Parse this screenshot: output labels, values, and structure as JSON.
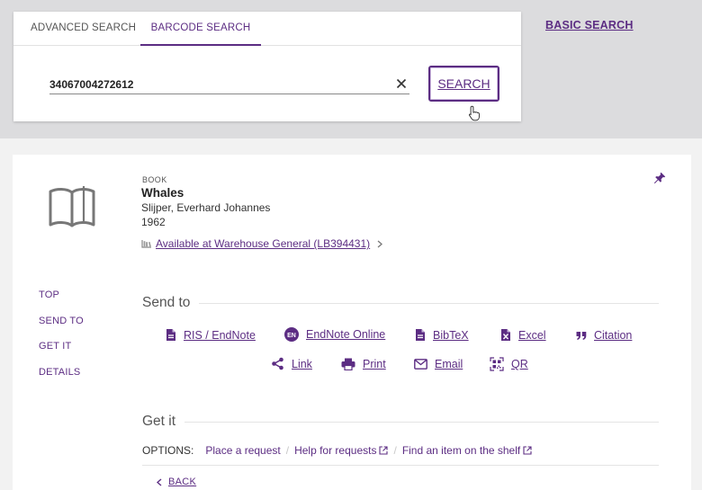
{
  "search": {
    "tabs": [
      {
        "label": "ADVANCED SEARCH"
      },
      {
        "label": "BARCODE SEARCH"
      }
    ],
    "barcode_value": "34067004272612",
    "search_button": "SEARCH",
    "basic_search": "BASIC SEARCH"
  },
  "record": {
    "type": "BOOK",
    "title": "Whales",
    "author": "Slijper, Everhard Johannes",
    "year": "1962",
    "availability": "Available at Warehouse  General (LB394431)"
  },
  "side_nav": [
    "TOP",
    "SEND TO",
    "GET IT",
    "DETAILS"
  ],
  "send_to": {
    "heading": "Send to",
    "actions": [
      {
        "label": "RIS / EndNote",
        "icon": "document-icon"
      },
      {
        "label": "EndNote Online",
        "icon": "endnote-badge-icon",
        "badge": "EN"
      },
      {
        "label": "BibTeX",
        "icon": "document-icon"
      },
      {
        "label": "Excel",
        "icon": "excel-icon"
      },
      {
        "label": "Citation",
        "icon": "quote-icon"
      },
      {
        "label": "Link",
        "icon": "share-icon"
      },
      {
        "label": "Print",
        "icon": "printer-icon"
      },
      {
        "label": "Email",
        "icon": "envelope-icon"
      },
      {
        "label": "QR",
        "icon": "qr-code-icon"
      }
    ]
  },
  "get_it": {
    "heading": "Get it",
    "options_label": "OPTIONS:",
    "options": [
      "Place a request",
      "Help for requests",
      "Find an item on the shelf"
    ],
    "back": "BACK"
  },
  "colors": {
    "accent": "#5c2d83",
    "band": "#dcdcde",
    "page_bg": "#f2f2f2"
  }
}
